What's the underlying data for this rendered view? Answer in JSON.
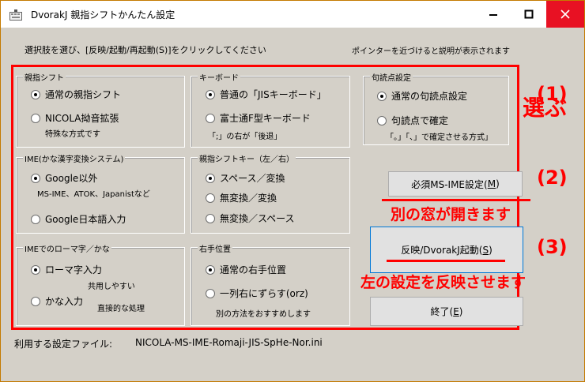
{
  "window": {
    "title": "DvorakJ 親指シフトかんたん設定",
    "controls": {
      "minimize": "—",
      "maximize": "☐",
      "close": "✕"
    }
  },
  "instructions": {
    "left": "選択肢を選び、[反映/起動/再起動(S)]をクリックしてください",
    "right": "ポインターを近づけると説明が表示されます"
  },
  "groups": {
    "oyayubi_shift": {
      "legend": "親指シフト",
      "options": [
        {
          "label": "通常の親指シフト",
          "selected": true
        },
        {
          "label": "NICOLA拗音拡張",
          "selected": false,
          "note": "特殊な方式です"
        }
      ]
    },
    "keyboard": {
      "legend": "キーボード",
      "options": [
        {
          "label": "普通の「JISキーボード」",
          "selected": true
        },
        {
          "label": "富士通F型キーボード",
          "selected": false,
          "note": "「;」の右が「後退」"
        }
      ]
    },
    "kutouten": {
      "legend": "句読点設定",
      "options": [
        {
          "label": "通常の句読点設定",
          "selected": true
        },
        {
          "label": "句読点で確定",
          "selected": false,
          "note": "「。」「、」で確定させる方式」"
        }
      ]
    },
    "ime": {
      "legend": "IME(かな漢字変換システム)",
      "options": [
        {
          "label": "Google以外",
          "selected": true,
          "note": "MS-IME、ATOK、Japanistなど"
        },
        {
          "label": "Google日本語入力",
          "selected": false
        }
      ]
    },
    "oyayubi_key": {
      "legend": "親指シフトキー（左／右）",
      "options": [
        {
          "label": "スペース／変換",
          "selected": true
        },
        {
          "label": "無変換／変換",
          "selected": false
        },
        {
          "label": "無変換／スペース",
          "selected": false
        }
      ]
    },
    "romaji": {
      "legend": "IMEでのローマ字／かな",
      "options": [
        {
          "label": "ローマ字入力",
          "selected": true,
          "note": "共用しやすい"
        },
        {
          "label": "かな入力",
          "selected": false,
          "note": "直接的な処理"
        }
      ]
    },
    "right_hand": {
      "legend": "右手位置",
      "options": [
        {
          "label": "通常の右手位置",
          "selected": true
        },
        {
          "label": "一列右にずらす(orz)",
          "selected": false,
          "note": "別の方法をおすすめします"
        }
      ]
    }
  },
  "buttons": {
    "ms_ime": {
      "label": "必須MS-IME設定(",
      "mnemonic": "M",
      "tail": ")"
    },
    "apply": {
      "label": "反映/DvorakJ起動(",
      "mnemonic": "S",
      "tail": ")"
    },
    "exit": {
      "label": "終了(",
      "mnemonic": "E",
      "tail": ")"
    }
  },
  "annotations": {
    "step1": "(1)",
    "step1_text": "選ぶ",
    "step2": "(2)",
    "step2_text": "別の窓が開きます",
    "step3": "(3)",
    "step3_text": "左の設定を反映させます"
  },
  "footer": {
    "label": "利用する設定ファイル:",
    "file": "NICOLA-MS-IME-Romaji-JIS-SpHe-Nor.ini"
  },
  "colors": {
    "accent": "#ff0000",
    "close_button": "#e81123",
    "window_bg": "#d4d0c8",
    "focus_border": "#0078d7"
  }
}
